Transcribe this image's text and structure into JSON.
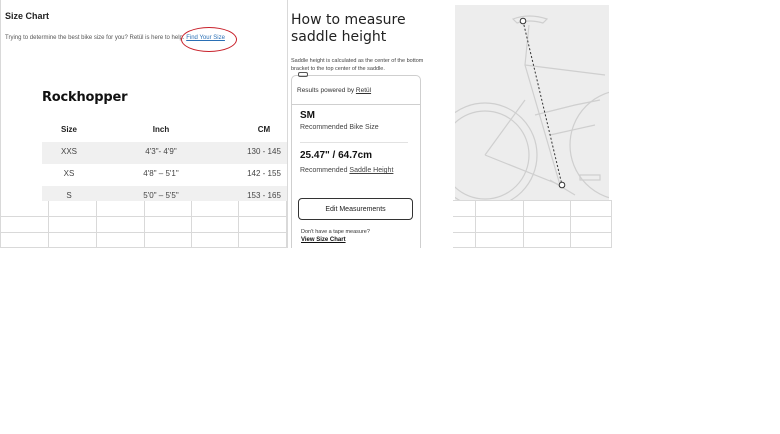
{
  "size_chart": {
    "title": "Size Chart",
    "intro_text": "Trying to determine the best bike size for you? Retül is here to help.",
    "find_link": "Find Your Size",
    "model_name": "Rockhopper",
    "columns": [
      "Size",
      "Inch",
      "CM"
    ],
    "rows": [
      {
        "size": "XXS",
        "inch": "4'3\"- 4'9\"",
        "cm": "130 - 145"
      },
      {
        "size": "XS",
        "inch": "4'8\" – 5'1\"",
        "cm": "142 - 155"
      },
      {
        "size": "S",
        "inch": "5'0\" – 5'5\"",
        "cm": "153 - 165"
      }
    ]
  },
  "measure": {
    "title": "How to measure saddle height",
    "description": "Saddle height is calculated as the center of the bottom bracket to the top center of the saddle.",
    "powered_prefix": "Results powered by ",
    "powered_link": "Retül",
    "size_value": "SM",
    "size_label": "Recommended Bike Size",
    "height_value": "25.47\" / 64.7cm",
    "height_prefix": "Recommended ",
    "height_link": "Saddle Height",
    "edit_button": "Edit Measurements",
    "tape_question": "Don't have a tape measure?",
    "view_chart_link": "View Size Chart"
  },
  "colors": {
    "link": "#2a6fb5",
    "highlight_circle": "#c8202a",
    "row_shade": "#f0f0f0",
    "image_bg": "#ededed"
  }
}
